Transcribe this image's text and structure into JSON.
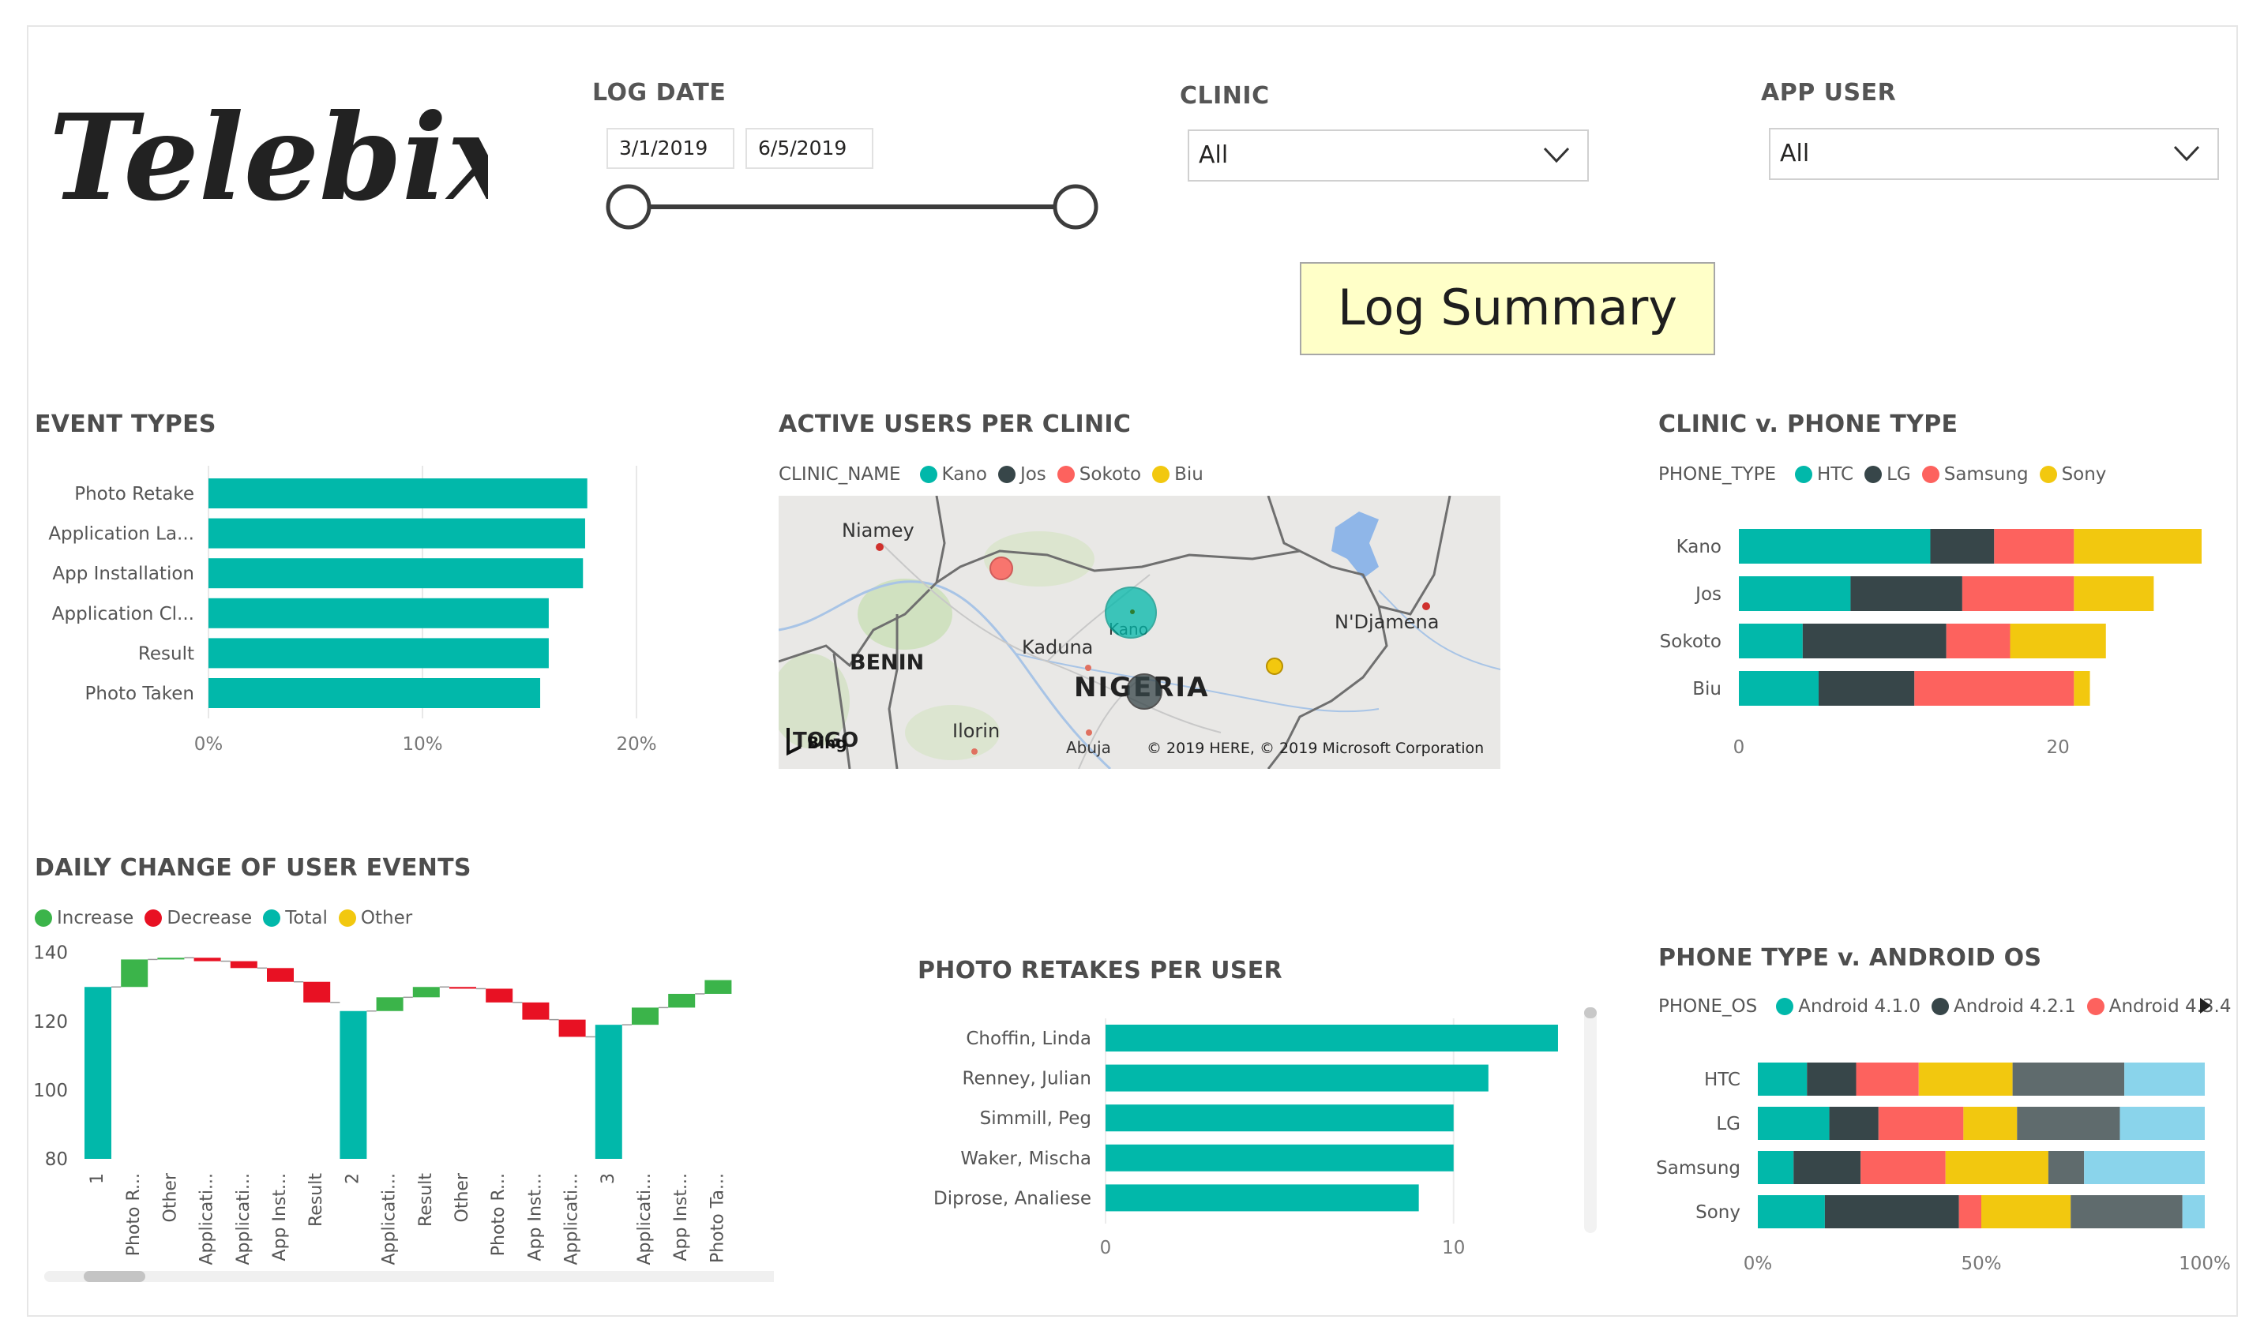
{
  "logo": {
    "text": "Telebix"
  },
  "log_date": {
    "title": "LOG DATE",
    "start": "3/1/2019",
    "end": "6/5/2019"
  },
  "clinic": {
    "title": "CLINIC",
    "value": "All"
  },
  "app_user": {
    "title": "APP USER",
    "value": "All"
  },
  "banner": {
    "text": "Log Summary"
  },
  "colors": {
    "teal": "#01b8aa",
    "dark": "#374649",
    "red": "#fd625e",
    "yellow": "#f2c80f",
    "gray": "#5f6b6d",
    "lightblue": "#8ad4eb",
    "green": "#3bb44a",
    "decrease": "#e81123"
  },
  "event_types": {
    "title": "EVENT TYPES",
    "chart_data": {
      "type": "bar",
      "categories": [
        "Photo Retake",
        "Application La...",
        "App Installation",
        "Application Cl...",
        "Result",
        "Photo Taken"
      ],
      "values": [
        17.7,
        17.6,
        17.5,
        15.9,
        15.9,
        15.5
      ],
      "xticks": [
        "0%",
        "10%",
        "20%"
      ],
      "xlim": [
        0,
        20
      ]
    }
  },
  "active_users": {
    "title": "ACTIVE USERS PER CLINIC",
    "legend_label": "CLINIC_NAME",
    "legend": [
      "Kano",
      "Jos",
      "Sokoto",
      "Biu"
    ],
    "map_labels": {
      "niamey": "Niamey",
      "benin": "BENIN",
      "kaduna": "Kaduna",
      "kano": "Kano",
      "ndjamena": "N'Djamena",
      "nigeria": "NIGERIA",
      "ilorin": "Ilorin",
      "abuja": "Abuja",
      "togo": "TOGO",
      "bing": "Bing"
    },
    "copyright": "© 2019 HERE, © 2019 Microsoft Corporation"
  },
  "clinic_phone": {
    "title": "CLINIC v. PHONE TYPE",
    "legend_label": "PHONE_TYPE",
    "chart_data": {
      "type": "bar",
      "stacked": true,
      "categories": [
        "Kano",
        "Jos",
        "Sokoto",
        "Biu"
      ],
      "series": [
        {
          "name": "HTC",
          "values": [
            12,
            7,
            4,
            5
          ]
        },
        {
          "name": "LG",
          "values": [
            4,
            7,
            9,
            6
          ]
        },
        {
          "name": "Samsung",
          "values": [
            5,
            7,
            4,
            10
          ]
        },
        {
          "name": "Sony",
          "values": [
            8,
            5,
            6,
            1
          ]
        }
      ],
      "xticks": [
        "0",
        "20"
      ],
      "xlim": [
        0,
        29
      ]
    }
  },
  "daily_change": {
    "title": "DAILY CHANGE OF USER EVENTS",
    "legend": [
      "Increase",
      "Decrease",
      "Total",
      "Other"
    ],
    "chart_data": {
      "type": "bar",
      "subtype": "waterfall",
      "categories": [
        "1",
        "Photo R...",
        "Other",
        "Applicati...",
        "Applicati...",
        "App Inst...",
        "Result",
        "2",
        "Applicati...",
        "Result",
        "Other",
        "Photo R...",
        "App Inst...",
        "Applicati...",
        "3",
        "Applicati...",
        "App Inst...",
        "Photo Ta..."
      ],
      "values": [
        130,
        8,
        0.5,
        -1,
        -2,
        -4,
        -6,
        123,
        4,
        3,
        -0.5,
        -4,
        -5,
        -5,
        119,
        5,
        4,
        4
      ],
      "kinds": [
        "total",
        "increase",
        "increase",
        "decrease",
        "decrease",
        "decrease",
        "decrease",
        "total",
        "increase",
        "increase",
        "decrease",
        "decrease",
        "decrease",
        "decrease",
        "total",
        "increase",
        "increase",
        "increase"
      ],
      "ylim": [
        80,
        142
      ],
      "yticks": [
        "80",
        "100",
        "120",
        "140"
      ]
    }
  },
  "photo_retakes": {
    "title": "PHOTO RETAKES PER USER",
    "chart_data": {
      "type": "bar",
      "categories": [
        "Choffin, Linda",
        "Renney, Julian",
        "Simmill, Peg",
        "Waker, Mischa",
        "Diprose, Analiese"
      ],
      "values": [
        13,
        11,
        10,
        10,
        9
      ],
      "xticks": [
        "0",
        "10"
      ],
      "xlim": [
        0,
        13.5
      ]
    }
  },
  "phone_os": {
    "title": "PHONE TYPE v. ANDROID OS",
    "legend_label": "PHONE_OS",
    "legend": [
      "Android 4.1.0",
      "Android 4.2.1",
      "Android 4.3.4"
    ],
    "chart_data": {
      "type": "bar",
      "stacked100": true,
      "categories": [
        "HTC",
        "LG",
        "Samsung",
        "Sony"
      ],
      "series": [
        {
          "values": [
            11,
            16,
            8,
            15
          ]
        },
        {
          "values": [
            11,
            11,
            15,
            30
          ]
        },
        {
          "values": [
            14,
            19,
            19,
            5
          ]
        },
        {
          "values": [
            21,
            12,
            23,
            20
          ]
        },
        {
          "values": [
            25,
            23,
            8,
            25
          ]
        },
        {
          "values": [
            18,
            19,
            27,
            5
          ]
        }
      ],
      "xticks": [
        "0%",
        "50%",
        "100%"
      ]
    }
  }
}
